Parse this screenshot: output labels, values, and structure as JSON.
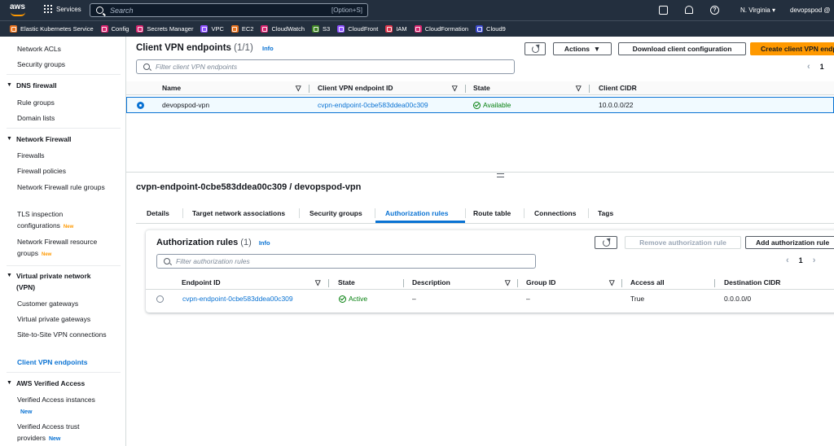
{
  "topnav": {
    "services_label": "Services",
    "search_placeholder": "Search",
    "search_shortcut": "[Option+S]",
    "region": "N. Virginia",
    "account": "devopspod @"
  },
  "favorites": [
    {
      "label": "Elastic Kubernetes Service",
      "color": "#e7721e"
    },
    {
      "label": "Config",
      "color": "#d6246e"
    },
    {
      "label": "Secrets Manager",
      "color": "#d6246e"
    },
    {
      "label": "VPC",
      "color": "#8c4fff"
    },
    {
      "label": "EC2",
      "color": "#e7721e"
    },
    {
      "label": "CloudWatch",
      "color": "#d6246e"
    },
    {
      "label": "S3",
      "color": "#3f8624"
    },
    {
      "label": "CloudFront",
      "color": "#8c4fff"
    },
    {
      "label": "IAM",
      "color": "#dd344c"
    },
    {
      "label": "CloudFormation",
      "color": "#d6246e"
    },
    {
      "label": "Cloud9",
      "color": "#3b48cc"
    }
  ],
  "sidebar": {
    "new_badge": "New",
    "items": [
      {
        "label": "Network ACLs"
      },
      {
        "label": "Security groups"
      },
      {
        "label": "DNS firewall"
      },
      {
        "label": "Rule groups"
      },
      {
        "label": "Domain lists"
      },
      {
        "label": "Network Firewall"
      },
      {
        "label": "Firewalls"
      },
      {
        "label": "Firewall policies"
      },
      {
        "label": "Network Firewall rule groups"
      },
      {
        "label": "TLS inspection configurations"
      },
      {
        "label": "Network Firewall resource groups"
      },
      {
        "label": "Virtual private network (VPN)"
      },
      {
        "label": "Customer gateways"
      },
      {
        "label": "Virtual private gateways"
      },
      {
        "label": "Site-to-Site VPN connections"
      },
      {
        "label": "Client VPN endpoints"
      },
      {
        "label": "AWS Verified Access"
      },
      {
        "label": "Verified Access instances"
      },
      {
        "label": "Verified Access trust providers"
      }
    ]
  },
  "endpoints_panel": {
    "title": "Client VPN endpoints",
    "count": "(1/1)",
    "info": "Info",
    "actions_label": "Actions",
    "download_label": "Download client configuration",
    "create_label": "Create client VPN endpoint",
    "filter_placeholder": "Filter client VPN endpoints",
    "page": "1",
    "columns": [
      "Name",
      "Client VPN endpoint ID",
      "State",
      "Client CIDR"
    ],
    "rows": [
      {
        "name": "devopspod-vpn",
        "id": "cvpn-endpoint-0cbe583ddea00c309",
        "state": "Available",
        "cidr": "10.0.0.0/22"
      }
    ]
  },
  "detail": {
    "title": "cvpn-endpoint-0cbe583ddea00c309 / devopspod-vpn",
    "tabs": [
      "Details",
      "Target network associations",
      "Security groups",
      "Authorization rules",
      "Route table",
      "Connections",
      "Tags"
    ],
    "active_tab": "Authorization rules"
  },
  "auth_rules": {
    "title": "Authorization rules",
    "count": "(1)",
    "info": "Info",
    "remove_label": "Remove authorization rule",
    "add_label": "Add authorization rule",
    "filter_placeholder": "Filter authorization rules",
    "page": "1",
    "columns": [
      "Endpoint ID",
      "State",
      "Description",
      "Group ID",
      "Access all",
      "Destination CIDR"
    ],
    "rows": [
      {
        "endpoint_id": "cvpn-endpoint-0cbe583ddea00c309",
        "state": "Active",
        "description": "–",
        "group_id": "–",
        "access_all": "True",
        "destination_cidr": "0.0.0.0/0"
      }
    ]
  }
}
